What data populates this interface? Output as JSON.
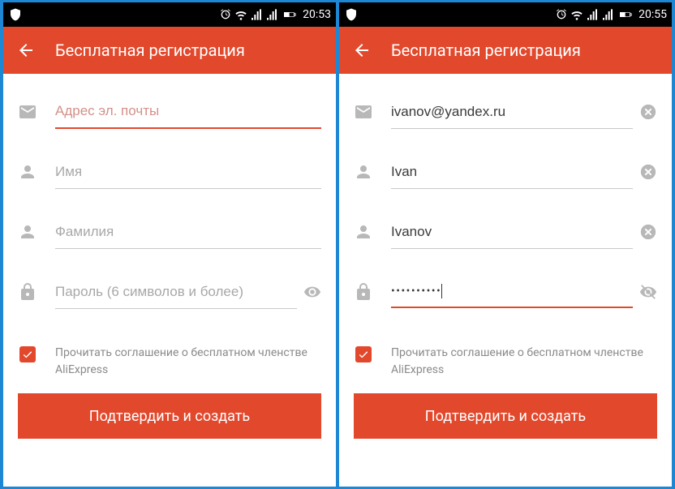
{
  "left": {
    "status_time": "20:53",
    "header_title": "Бесплатная регистрация",
    "email_placeholder": "Адрес эл. почты",
    "name_placeholder": "Имя",
    "surname_placeholder": "Фамилия",
    "password_placeholder": "Пароль (6 символов и более)",
    "agreement_text": "Прочитать соглашение о бесплатном членстве AliExpress",
    "submit_label": "Подтвердить и создать"
  },
  "right": {
    "status_time": "20:55",
    "header_title": "Бесплатная регистрация",
    "email_value": "ivanov@yandex.ru",
    "name_value": "Ivan",
    "surname_value": "Ivanov",
    "password_display": "••••••••••",
    "agreement_text": "Прочитать соглашение о бесплатном членстве AliExpress",
    "submit_label": "Подтвердить и создать"
  }
}
